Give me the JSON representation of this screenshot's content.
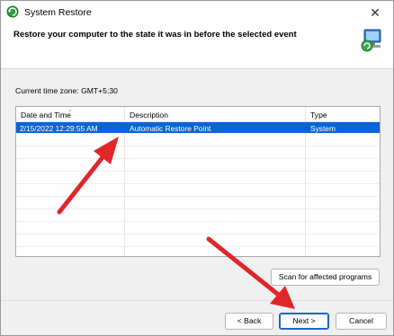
{
  "window": {
    "title": "System Restore",
    "close_glyph": "✕"
  },
  "header": {
    "title": "Restore your computer to the state it was in before the selected event"
  },
  "timezone": {
    "label": "Current time zone: GMT+5:30"
  },
  "table": {
    "columns": [
      "Date and Time",
      "Description",
      "Type"
    ],
    "rows": [
      {
        "date": "2/15/2022 12:29:55 AM",
        "description": "Automatic Restore Point",
        "type": "System",
        "selected": true
      }
    ]
  },
  "buttons": {
    "scan": "Scan for affected programs",
    "back": "< Back",
    "next": "Next >",
    "cancel": "Cancel"
  },
  "colors": {
    "selection": "#0a64d8",
    "arrow": "#e0262b",
    "primary_border": "#1b66c9"
  },
  "icons": {
    "title": "system-restore-icon",
    "header": "computer-restore-icon",
    "close": "close-icon"
  }
}
